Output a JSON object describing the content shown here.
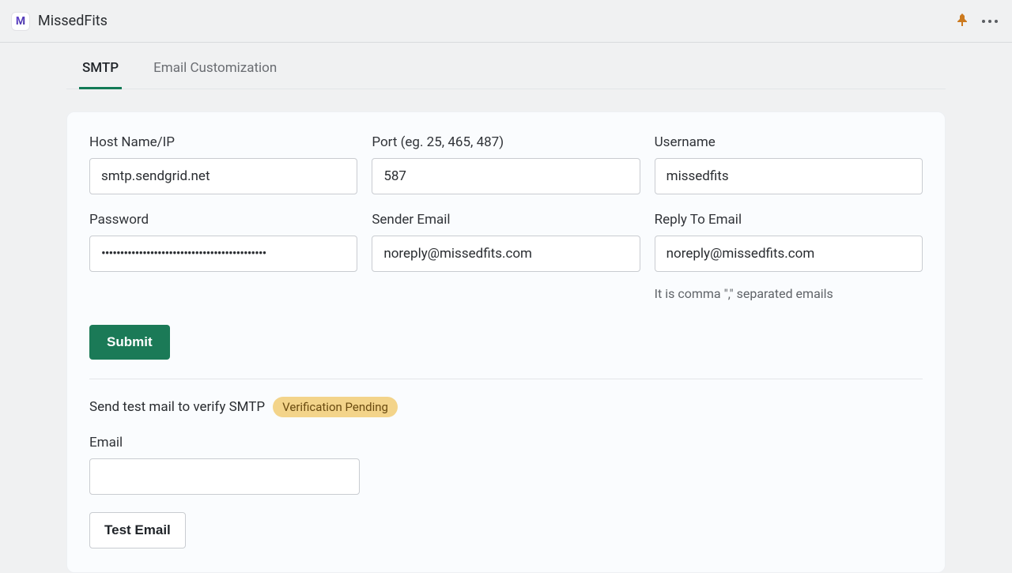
{
  "app": {
    "name": "MissedFits",
    "logo_letter": "M"
  },
  "tabs": {
    "smtp": "SMTP",
    "email_custom": "Email Customization"
  },
  "fields": {
    "host": {
      "label": "Host Name/IP",
      "value": "smtp.sendgrid.net"
    },
    "port": {
      "label": "Port (eg. 25, 465, 487)",
      "value": "587"
    },
    "username": {
      "label": "Username",
      "value": "missedfits"
    },
    "password": {
      "label": "Password",
      "value": "••••••••••••••••••••••••••••••••••••••••••••"
    },
    "sender": {
      "label": "Sender Email",
      "value": "noreply@missedfits.com"
    },
    "reply_to": {
      "label": "Reply To Email",
      "value": "noreply@missedfits.com",
      "helper": "It is comma \",\" separated emails"
    }
  },
  "buttons": {
    "submit": "Submit",
    "test_email": "Test Email"
  },
  "verify": {
    "text": "Send test mail to verify SMTP",
    "badge": "Verification Pending"
  },
  "test": {
    "label": "Email",
    "value": ""
  }
}
